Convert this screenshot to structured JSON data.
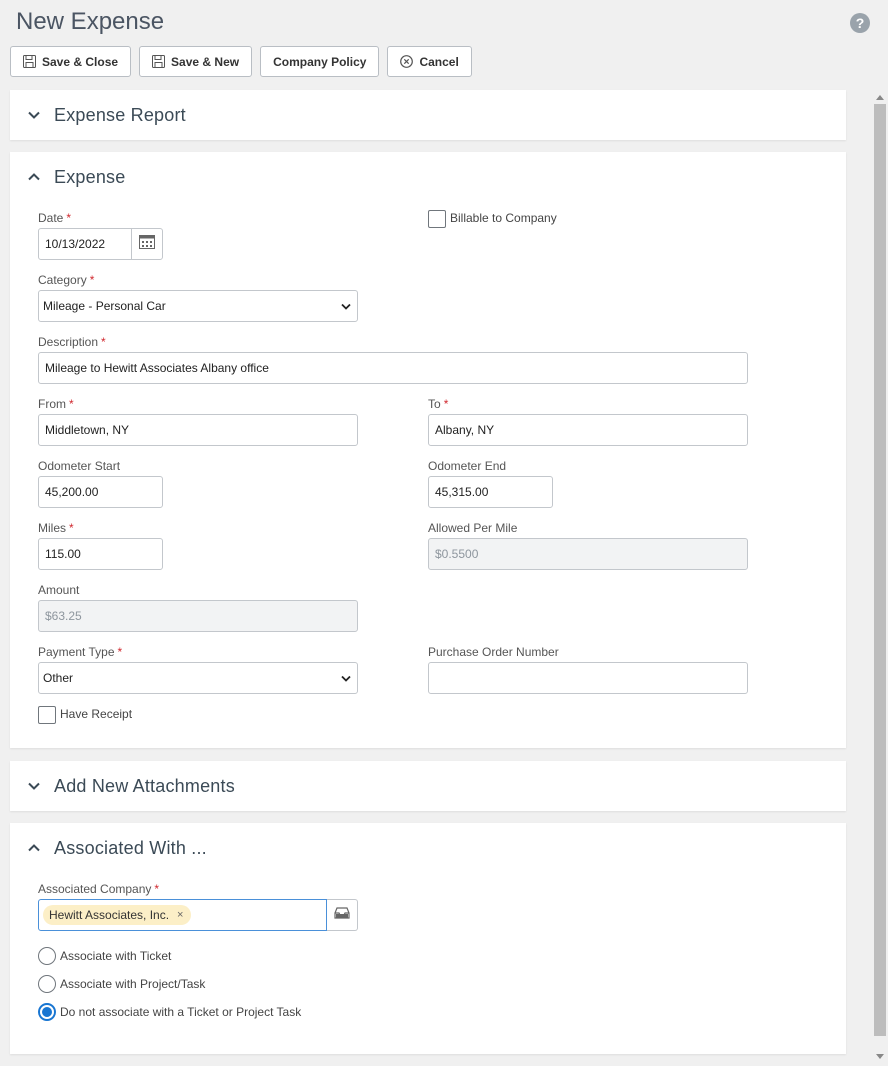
{
  "page": {
    "title": "New Expense"
  },
  "toolbar": {
    "save_close": "Save & Close",
    "save_new": "Save & New",
    "company_policy": "Company Policy",
    "cancel": "Cancel"
  },
  "sections": {
    "expense_report": {
      "title": "Expense Report"
    },
    "expense": {
      "title": "Expense"
    },
    "attachments": {
      "title": "Add New Attachments"
    },
    "associated": {
      "title": "Associated With ..."
    }
  },
  "expense": {
    "date": {
      "label": "Date",
      "value": "10/13/2022"
    },
    "billable": {
      "label": "Billable to Company",
      "checked": false
    },
    "category": {
      "label": "Category",
      "value": "Mileage - Personal Car"
    },
    "description": {
      "label": "Description",
      "value": "Mileage to Hewitt Associates Albany office"
    },
    "from": {
      "label": "From",
      "value": "Middletown, NY"
    },
    "to": {
      "label": "To",
      "value": "Albany, NY"
    },
    "odometer_start": {
      "label": "Odometer Start",
      "value": "45,200.00"
    },
    "odometer_end": {
      "label": "Odometer End",
      "value": "45,315.00"
    },
    "miles": {
      "label": "Miles",
      "value": "115.00"
    },
    "allowed_per_mile": {
      "label": "Allowed Per Mile",
      "value": "$0.5500"
    },
    "amount": {
      "label": "Amount",
      "value": "$63.25"
    },
    "payment_type": {
      "label": "Payment Type",
      "value": "Other"
    },
    "purchase_order": {
      "label": "Purchase Order Number",
      "value": ""
    },
    "have_receipt": {
      "label": "Have Receipt",
      "checked": false
    }
  },
  "associated": {
    "company_label": "Associated Company",
    "company_tag": "Hewitt Associates, Inc.",
    "options": [
      {
        "label": "Associate with Ticket",
        "checked": false
      },
      {
        "label": "Associate with Project/Task",
        "checked": false
      },
      {
        "label": "Do not associate with a Ticket or Project Task",
        "checked": true
      }
    ]
  },
  "required_mark": "*",
  "icons": {
    "help": "?",
    "tag_remove": "×"
  },
  "colors": {
    "accent": "#1976d2",
    "required": "#d0282e",
    "tag_bg": "#fcefc7",
    "background": "#f0f0f0"
  }
}
